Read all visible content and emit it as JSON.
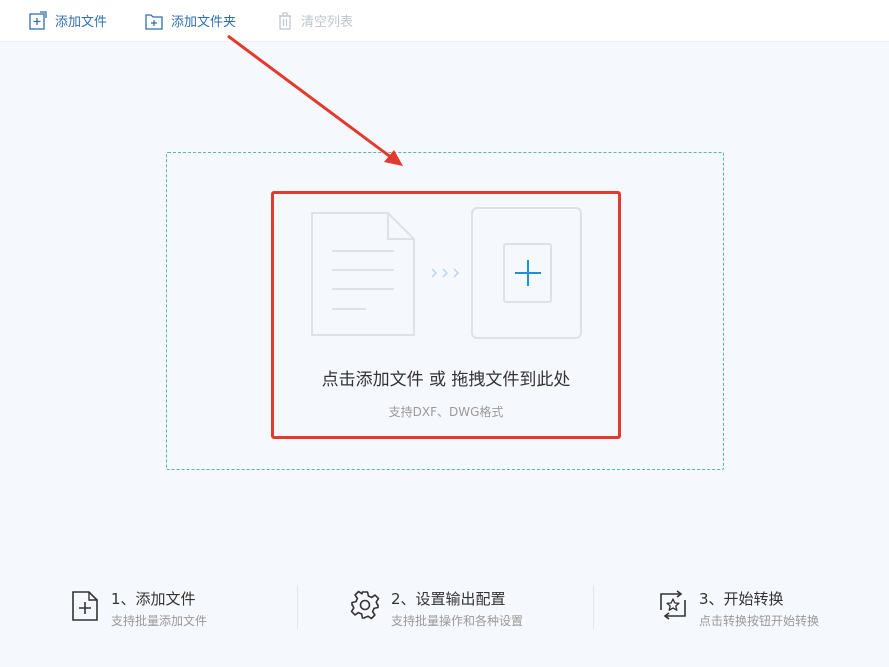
{
  "toolbar": {
    "add_file": "添加文件",
    "add_folder": "添加文件夹",
    "clear_list": "清空列表"
  },
  "dropzone": {
    "main_text": "点击添加文件 或 拖拽文件到此处",
    "sub_text": "支持DXF、DWG格式"
  },
  "steps": [
    {
      "title": "1、添加文件",
      "desc": "支持批量添加文件",
      "icon": "file-add-icon"
    },
    {
      "title": "2、设置输出配置",
      "desc": "支持批量操作和各种设置",
      "icon": "gear-icon"
    },
    {
      "title": "3、开始转换",
      "desc": "点击转换按钮开始转换",
      "icon": "convert-star-icon"
    }
  ],
  "colors": {
    "accent": "#2f6fb0",
    "plus": "#1e8ed6",
    "dashed_border": "#5bb3b0",
    "annotation_red": "#e23a2c",
    "background": "#f5f8fc"
  }
}
